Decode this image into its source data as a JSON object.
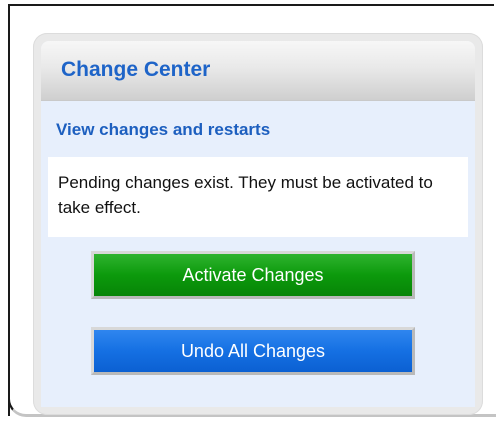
{
  "change_center": {
    "title": "Change Center",
    "view_link": "View changes and restarts",
    "message": "Pending changes exist. They must be activated to take effect.",
    "activate_label": "Activate Changes",
    "undo_label": "Undo All Changes"
  },
  "colors": {
    "title_blue": "#1e64c8",
    "activate_green": "#0c9a0c",
    "undo_blue": "#1570e3",
    "panel_bg": "#e7effc"
  }
}
